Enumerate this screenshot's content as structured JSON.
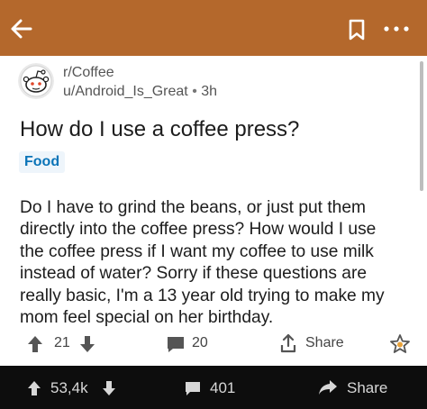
{
  "colors": {
    "header_bg": "#b4682c",
    "flair_text": "#0a74b8",
    "flair_bg": "#eef5fb",
    "bottom_bar_bg": "#0d0d0d"
  },
  "header": {
    "back_icon": "arrow-left-icon",
    "save_icon": "bookmark-icon",
    "more_icon": "more-horizontal-icon"
  },
  "post": {
    "subreddit": "r/Coffee",
    "author": "u/Android_Is_Great",
    "separator": "•",
    "age": "3h",
    "title": "How do I use a coffee press?",
    "flair": "Food",
    "body_lines": [
      "Do I have to grind the beans, or just put them",
      "directly into the coffee press? How would I use",
      "the coffee press if I want my coffee to use milk",
      "instead of water? Sorry if these questions are",
      "really basic, I'm a 13 year old trying to make my",
      "mom feel special on her birthday."
    ]
  },
  "post_actions": {
    "score": "21",
    "comments": "20",
    "share_label": "Share"
  },
  "bottom_bar": {
    "score": "53,4k",
    "comments": "401",
    "share_label": "Share"
  }
}
